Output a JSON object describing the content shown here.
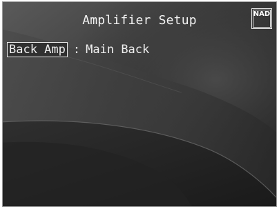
{
  "screen": {
    "title": "Amplifier Setup",
    "brand_logo": "NAD"
  },
  "setting": {
    "label": "Back Amp",
    "separator": ":",
    "value": "Main Back"
  },
  "colors": {
    "background_dark": "#2a2a2a",
    "text": "#f0f0f0",
    "highlight_border": "#e8e8e8"
  }
}
